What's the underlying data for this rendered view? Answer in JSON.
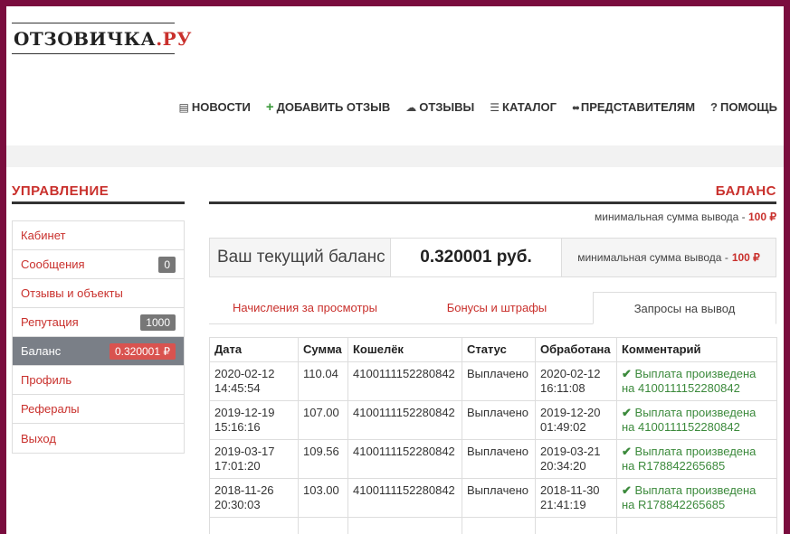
{
  "logo": {
    "main": "ОТЗОВИЧКА",
    "accent": ".РУ"
  },
  "nav": [
    {
      "icon": "newspaper-icon",
      "glyph": "▤",
      "label": "НОВОСТИ"
    },
    {
      "icon": "plus-icon",
      "glyph": "+",
      "label": "ДОБАВИТЬ ОТЗЫВ"
    },
    {
      "icon": "comments-icon",
      "glyph": "☁",
      "label": "ОТЗЫВЫ"
    },
    {
      "icon": "list-icon",
      "glyph": "☰",
      "label": "КАТАЛОГ"
    },
    {
      "icon": "users-icon",
      "glyph": "●●",
      "label": "ПРЕДСТАВИТЕЛЯМ"
    },
    {
      "icon": "question-icon",
      "glyph": "?",
      "label": "ПОМОЩЬ"
    }
  ],
  "sidebar": {
    "title": "УПРАВЛЕНИЕ",
    "items": [
      {
        "label": "Кабинет",
        "badge": ""
      },
      {
        "label": "Сообщения",
        "badge": "0"
      },
      {
        "label": "Отзывы и объекты",
        "badge": ""
      },
      {
        "label": "Репутация",
        "badge": "1000"
      },
      {
        "label": "Баланс",
        "badge": "0.320001 ₽"
      },
      {
        "label": "Профиль",
        "badge": ""
      },
      {
        "label": "Рефералы",
        "badge": ""
      },
      {
        "label": "Выход",
        "badge": ""
      }
    ]
  },
  "main": {
    "title": "БАЛАНС",
    "min_text": "минимальная сумма вывода -",
    "min_amount": "100 ₽",
    "balance_label": "Ваш текущий баланс",
    "balance_value": "0.320001 руб.",
    "box_min_text": "минимальная сумма вывода -",
    "box_min_amount": "100 ₽",
    "tabs": [
      "Начисления за просмотры",
      "Бонусы и штрафы",
      "Запросы на вывод"
    ]
  },
  "table": {
    "headers": [
      "Дата",
      "Сумма",
      "Кошелёк",
      "Статус",
      "Обработана",
      "Комментарий"
    ],
    "rows": [
      {
        "date1": "2020-02-12",
        "date2": "14:45:54",
        "sum": "110.04",
        "wallet": "4100111152280842",
        "status": "Выплачено",
        "proc1": "2020-02-12",
        "proc2": "16:11:08",
        "comment1": "Выплата произведена",
        "comment2": "на 4100111152280842"
      },
      {
        "date1": "2019-12-19",
        "date2": "15:16:16",
        "sum": "107.00",
        "wallet": "4100111152280842",
        "status": "Выплачено",
        "proc1": "2019-12-20",
        "proc2": "01:49:02",
        "comment1": "Выплата произведена",
        "comment2": "на 4100111152280842"
      },
      {
        "date1": "2019-03-17",
        "date2": "17:01:20",
        "sum": "109.56",
        "wallet": "4100111152280842",
        "status": "Выплачено",
        "proc1": "2019-03-21",
        "proc2": "20:34:20",
        "comment1": "Выплата произведена",
        "comment2": "на R178842265685"
      },
      {
        "date1": "2018-11-26",
        "date2": "20:30:03",
        "sum": "103.00",
        "wallet": "4100111152280842",
        "status": "Выплачено",
        "proc1": "2018-11-30",
        "proc2": "21:41:19",
        "comment1": "Выплата произведена",
        "comment2": "на R178842265685"
      }
    ]
  }
}
